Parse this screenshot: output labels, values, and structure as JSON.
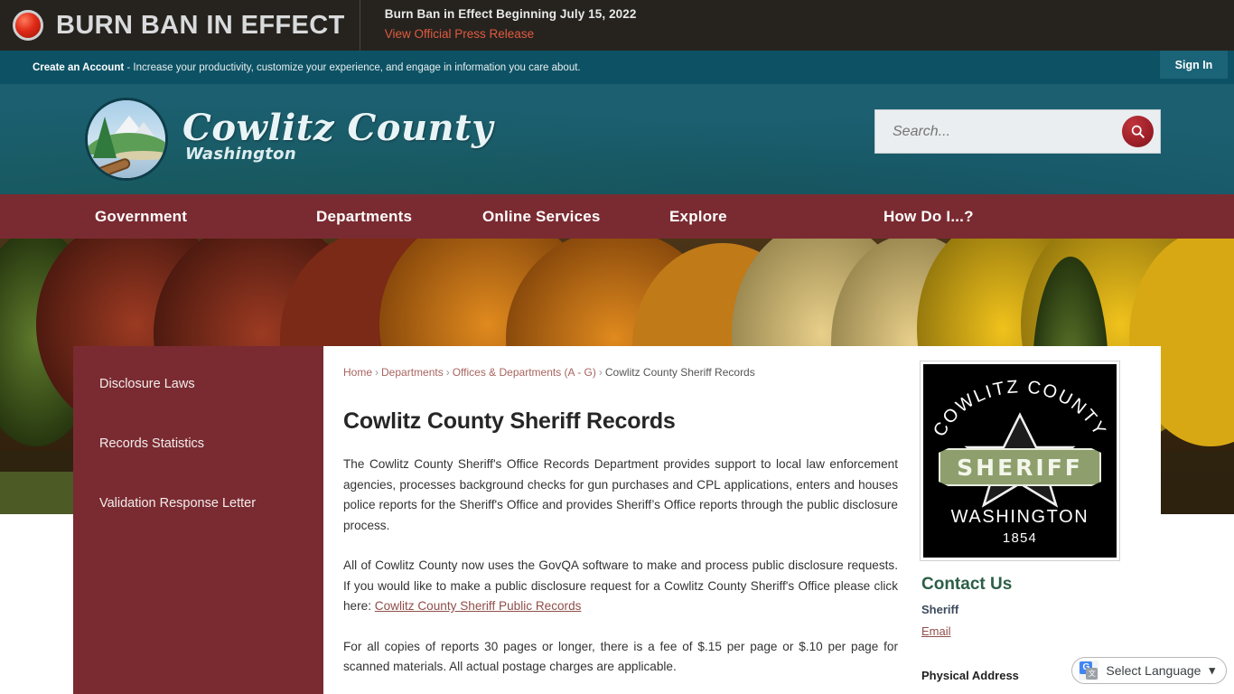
{
  "alert": {
    "icon": "red-circle-icon",
    "banner_title": "BURN BAN IN EFFECT",
    "headline": "Burn Ban in Effect Beginning July 15, 2022",
    "link_label": "View Official Press Release"
  },
  "account_bar": {
    "link_label": "Create an Account",
    "text": " - Increase your productivity, customize your experience, and engage in information you care about.",
    "sign_in_label": "Sign In"
  },
  "masthead": {
    "brand_name": "Cowlitz County",
    "brand_sub": "Washington",
    "logo_alt": "cowlitz-county-seal-icon"
  },
  "search": {
    "placeholder": "Search...",
    "value": "",
    "button_icon": "search-icon"
  },
  "nav": {
    "items": [
      {
        "label": "Government"
      },
      {
        "label": "Departments"
      },
      {
        "label": "Online Services"
      },
      {
        "label": "Explore"
      },
      {
        "label": "How Do I...?"
      }
    ]
  },
  "sidebar": {
    "items": [
      {
        "label": "Disclosure Laws"
      },
      {
        "label": "Records Statistics"
      },
      {
        "label": "Validation Response Letter"
      }
    ]
  },
  "breadcrumb": {
    "items": [
      {
        "label": "Home",
        "link": true
      },
      {
        "label": "Departments",
        "link": true
      },
      {
        "label": "Offices & Departments (A - G)",
        "link": true
      },
      {
        "label": "Cowlitz County Sheriff Records",
        "link": false
      }
    ],
    "separator": "›"
  },
  "main": {
    "page_title": "Cowlitz County Sheriff Records",
    "paragraph_1": "The Cowlitz County Sheriff's Office Records Department provides support to local law enforcement agencies, processes background checks for gun purchases and CPL applications, enters and houses police reports for the Sheriff's Office and provides Sheriff’s Office reports through the public disclosure process.",
    "paragraph_2_prefix": "All of Cowlitz County now uses the GovQA software to make and process public disclosure requests. If you would like to make a public disclosure request for a Cowlitz County Sheriff's Office please click here: ",
    "paragraph_2_link": "Cowlitz County Sheriff Public Records",
    "paragraph_3": "For all copies of reports 30 pages or longer, there is a fee of $.15 per page or $.10 per page for scanned materials. All actual postage charges are applicable."
  },
  "rail": {
    "badge": {
      "arc_text": "COWLITZ COUNTY",
      "ribbon_text": "SHERIFF",
      "state": "WASHINGTON",
      "year": "1854"
    },
    "contact_title": "Contact Us",
    "contact_name": "Sheriff",
    "email_label": "Email",
    "address_label": "Physical Address"
  },
  "translate": {
    "label": "Select Language",
    "icon": "google-translate-icon",
    "chevron": "⌄"
  },
  "colors": {
    "alert_bg": "#26231f",
    "alert_link": "#e05a3f",
    "account_bar": "#0d5264",
    "masthead": "#1b5f70",
    "nav_maroon": "#7a2b31",
    "sidebar_maroon": "#7a2b31",
    "search_btn": "#9d1f28",
    "contact_green": "#2c5f48",
    "link_maroon": "#8f4f4a",
    "ribbon_green": "#8e9f6d"
  }
}
